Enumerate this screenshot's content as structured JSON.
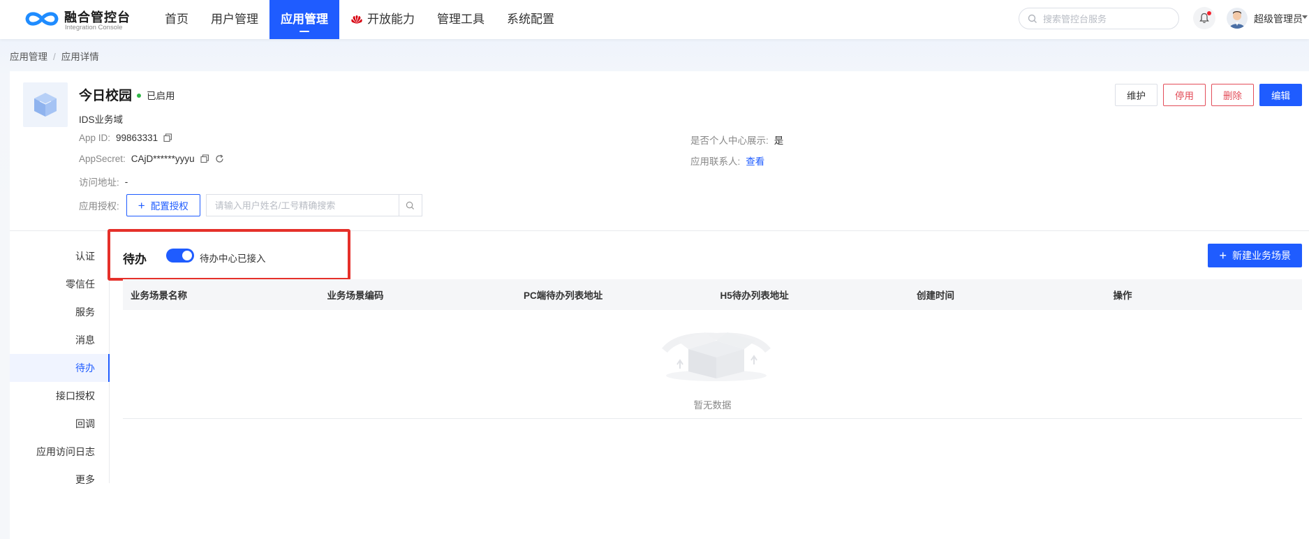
{
  "header": {
    "logo_title": "融合管控台",
    "logo_subtitle": "Integration Console",
    "nav": [
      {
        "label": "首页",
        "active": false
      },
      {
        "label": "用户管理",
        "active": false
      },
      {
        "label": "应用管理",
        "active": true
      },
      {
        "label": "开放能力",
        "active": false,
        "icon": "huawei-logo-icon"
      },
      {
        "label": "管理工具",
        "active": false
      },
      {
        "label": "系统配置",
        "active": false
      }
    ],
    "search_placeholder": "搜索管控台服务",
    "notification_icon": "bell-icon",
    "user_name": "超级管理员"
  },
  "breadcrumb": {
    "items": [
      "应用管理",
      "应用详情"
    ],
    "separator": "/"
  },
  "app": {
    "name": "今日校园",
    "status": "已启用",
    "domain": "IDS业务域",
    "app_id_label": "App ID:",
    "app_id": "99863331",
    "secret_label": "AppSecret:",
    "secret": "CAjD******yyyu",
    "url_label": "访问地址:",
    "url": "-",
    "auth_label": "应用授权:",
    "auth_button": "配置授权",
    "auth_search_placeholder": "请输入用户姓名/工号精确搜索",
    "personal_center_label": "是否个人中心展示:",
    "personal_center_value": "是",
    "contact_label": "应用联系人:",
    "contact_link": "查看"
  },
  "actions": {
    "maintain": "维护",
    "disable": "停用",
    "delete": "删除",
    "edit": "编辑"
  },
  "side_tabs": [
    {
      "label": "认证",
      "active": false
    },
    {
      "label": "零信任",
      "active": false
    },
    {
      "label": "服务",
      "active": false
    },
    {
      "label": "消息",
      "active": false
    },
    {
      "label": "待办",
      "active": true
    },
    {
      "label": "接口授权",
      "active": false
    },
    {
      "label": "回调",
      "active": false
    },
    {
      "label": "应用访问日志",
      "active": false
    },
    {
      "label": "更多",
      "active": false
    }
  ],
  "todo": {
    "title": "待办",
    "toggle_on": true,
    "toggle_text": "待办中心已接入",
    "new_button": "新建业务场景",
    "columns": [
      "业务场景名称",
      "业务场景编码",
      "PC端待办列表地址",
      "H5待办列表地址",
      "创建时间",
      "操作"
    ],
    "rows": [],
    "empty_text": "暂无数据"
  },
  "colors": {
    "primary": "#1f5cff",
    "danger": "#e34d59",
    "success": "#2fb546",
    "highlight": "#e5302a"
  }
}
